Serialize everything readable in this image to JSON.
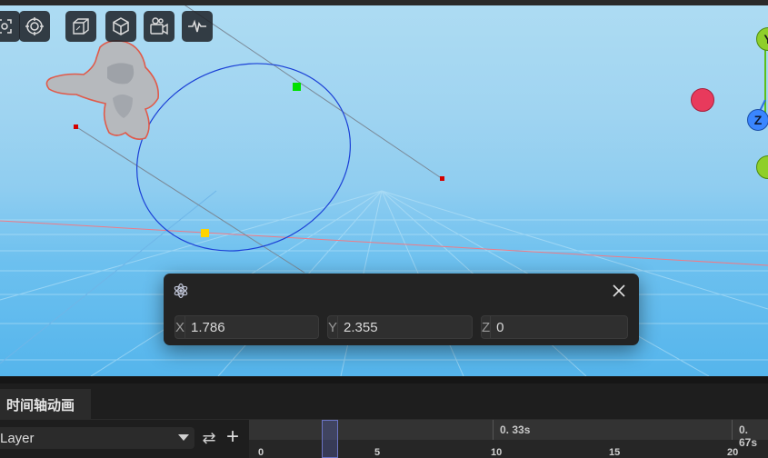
{
  "toolbar": {
    "buttons": [
      {
        "name": "frame-selection",
        "icon": "frame-select-icon"
      },
      {
        "name": "focus-target",
        "icon": "focus-target-icon"
      },
      {
        "name": "perspective-view",
        "icon": "perspective-cube-icon"
      },
      {
        "name": "object-mode",
        "icon": "cube-icon"
      },
      {
        "name": "camera-settings",
        "icon": "camera-icon"
      },
      {
        "name": "performance-monitor",
        "icon": "waveform-icon"
      }
    ]
  },
  "gizmo": {
    "y_label": "Y",
    "z_label": "Z"
  },
  "transform_panel": {
    "x_label": "X",
    "x_value": "1.786",
    "y_label": "Y",
    "y_value": "2.355",
    "z_label": "Z",
    "z_value": "0"
  },
  "timeline": {
    "tab_label": "时间轴动画",
    "layer_select": "Layer",
    "time_markers": [
      "0. 33s",
      "0. 67s"
    ],
    "frame_numbers": [
      "0",
      "5",
      "10",
      "15",
      "20"
    ]
  },
  "colors": {
    "accent": "#3a86ff",
    "curve": "#1a3fd6",
    "selection_outline": "#e05a4a",
    "control_green": "#00e000",
    "control_yellow": "#ffd400",
    "control_red": "#d40000"
  }
}
